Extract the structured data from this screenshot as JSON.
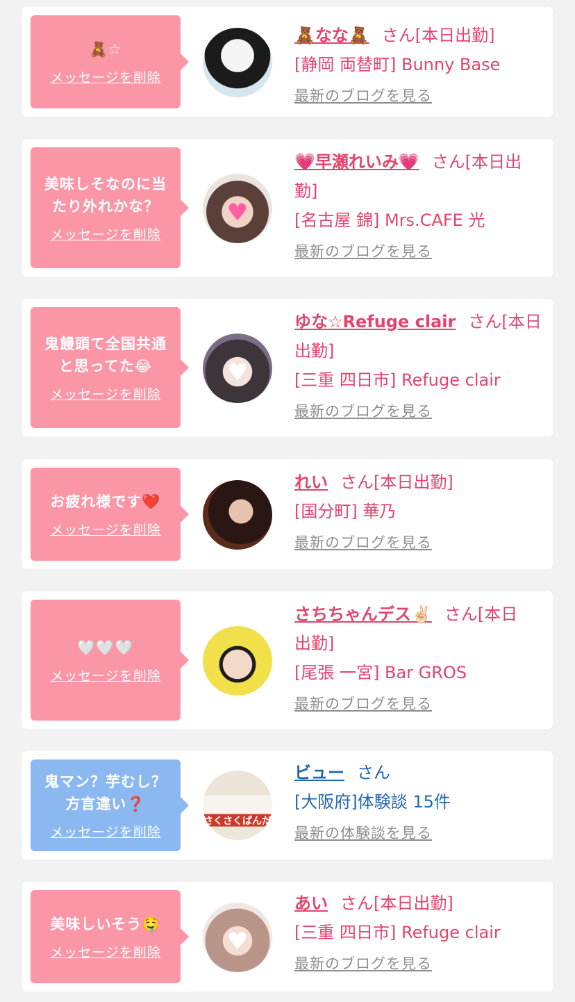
{
  "colors": {
    "bubble_pink": "#fb96a6",
    "bubble_blue": "#8cb8f2",
    "name_pink": "#e4436c",
    "name_blue": "#1e66ac",
    "link_gray": "#8e8e8e",
    "page_bg": "#f2f2f2",
    "card_bg": "#ffffff"
  },
  "delete_label": "メッセージを削除",
  "items": [
    {
      "message_lines": [
        "🧸☆"
      ],
      "name": "🧸なな🧸",
      "status_lines": [
        "さん[本日出勤]"
      ],
      "shop": "[静岡 両替町] Bunny Base",
      "link": "最新のブログを見る",
      "avatar_icon": "bunny-ears-avatar"
    },
    {
      "message_lines": [
        "美味しそなのに当",
        "たり外れかな？"
      ],
      "name": "💗早瀬れいみ💗",
      "status_lines": [
        "さん[本日出",
        "勤]"
      ],
      "shop": "[名古屋 錦] Mrs.CAFE 光",
      "link": "最新のブログを見る",
      "avatar_icon": "heart-face-avatar"
    },
    {
      "message_lines": [
        "鬼饅頭て全国共通",
        "と思ってた😂"
      ],
      "name": "ゆな☆Refuge clair",
      "status_lines": [
        "さん[本日",
        "出勤]"
      ],
      "shop": "[三重 四日市] Refuge clair",
      "link": "最新のブログを見る",
      "avatar_icon": "heart-face-avatar"
    },
    {
      "message_lines": [
        "お疲れ様です❤️"
      ],
      "name": "れい",
      "status_lines": [
        "さん[本日出勤]"
      ],
      "shop": "[国分町] 華乃",
      "link": "最新のブログを見る",
      "avatar_icon": "woman-avatar"
    },
    {
      "message_lines": [
        "🤍🤍🤍"
      ],
      "name": "さちちゃんデス✌🏻",
      "status_lines": [
        "さん[本日",
        "出勤]"
      ],
      "shop": "[尾張 一宮] Bar GROS",
      "link": "最新のブログを見る",
      "avatar_icon": "glasses-avatar"
    },
    {
      "message_lines": [
        "鬼マン？芋むし？",
        "方言違い❓"
      ],
      "name": "ビュー",
      "status_lines": [
        "さん"
      ],
      "shop": "[大阪府]体験談 15件",
      "link": "最新の体験談を見る",
      "avatar_icon": "snack-package-avatar",
      "avatar_text": "さくさくぱんだ"
    },
    {
      "message_lines": [
        "美味しいそう🤤"
      ],
      "name": "あい",
      "status_lines": [
        "さん[本日出勤]"
      ],
      "shop": "[三重 四日市] Refuge clair",
      "link": "最新のブログを見る",
      "avatar_icon": "heart-face-avatar"
    }
  ]
}
